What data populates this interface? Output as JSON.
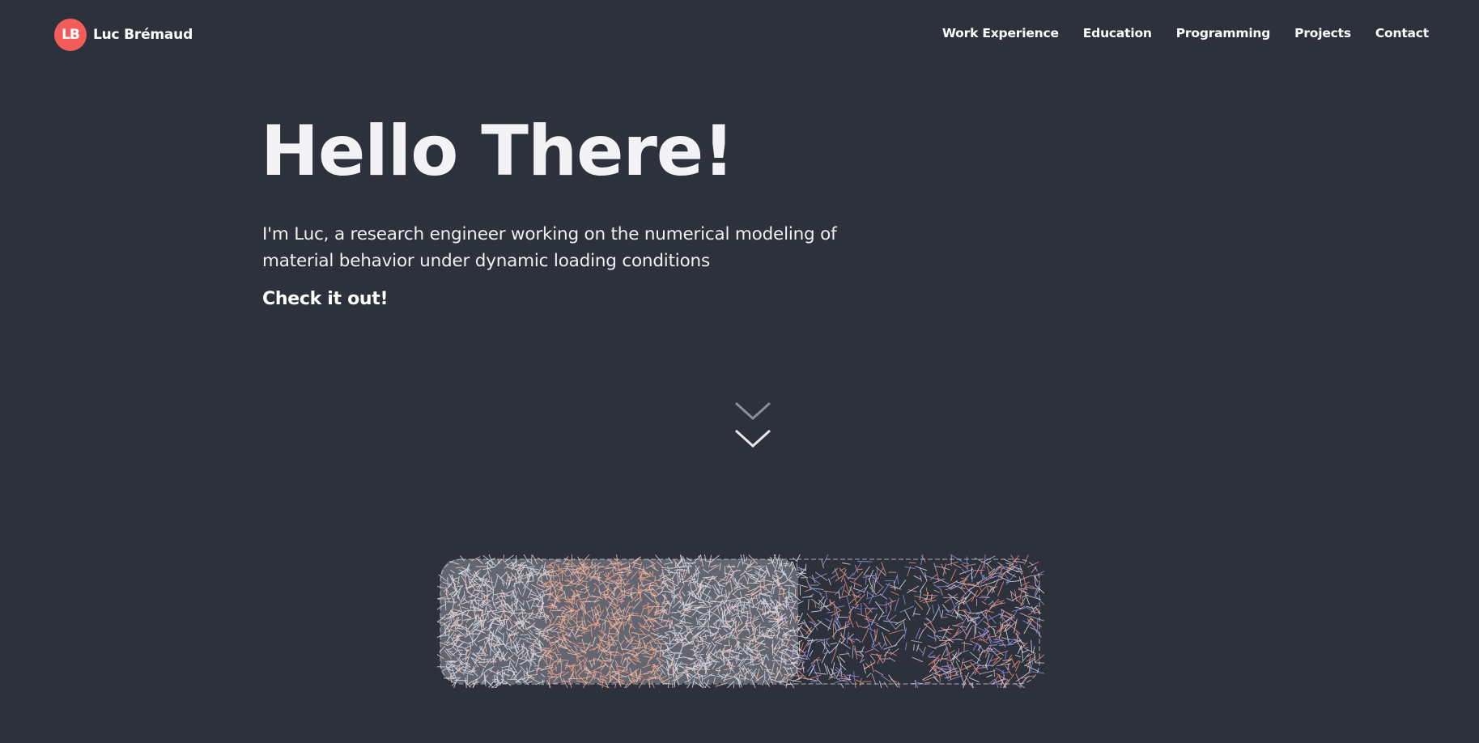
{
  "header": {
    "logo_initials": "LB",
    "brand_name": "Luc Brémaud",
    "nav": [
      {
        "label": "Work Experience"
      },
      {
        "label": "Education"
      },
      {
        "label": "Programming"
      },
      {
        "label": "Projects"
      },
      {
        "label": "Contact"
      }
    ]
  },
  "hero": {
    "title": "Hello There!",
    "subtitle": "I'm Luc, a research engineer working on the numerical modeling of material behavior under dynamic loading conditions",
    "cta": "Check it out!"
  },
  "colors": {
    "background": "#2d313c",
    "accent": "#f25d5b",
    "text": "#ffffff"
  },
  "icons": {
    "scroll": "double-chevron-down-icon"
  }
}
